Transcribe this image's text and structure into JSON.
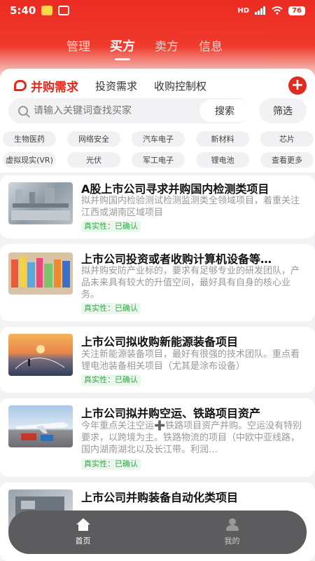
{
  "status_bar": {
    "time": "5:40",
    "signal": "HD",
    "battery": "76"
  },
  "top_tabs": [
    {
      "label": "管理"
    },
    {
      "label": "买方"
    },
    {
      "label": "卖方"
    },
    {
      "label": "信息"
    }
  ],
  "sub_tabs": [
    {
      "label": "并购需求"
    },
    {
      "label": "投资需求"
    },
    {
      "label": "收购控制权"
    }
  ],
  "search": {
    "placeholder": "请输入关键词查找买家",
    "button_label": "搜索",
    "filter_label": "筛选"
  },
  "chips_row1": [
    "生物医药",
    "网络安全",
    "汽车电子",
    "新材料",
    "芯片"
  ],
  "chips_row2": [
    "虚拟现实(VR)",
    "光伏",
    "军工电子",
    "锂电池",
    "查看更多"
  ],
  "cards": [
    {
      "title": "A股上市公司寻求并购国内检测类项目",
      "desc": "拟并购国内检验测试检测监测类全领域项目，着重关注江西或湖南区域项目",
      "badge": "真实性：已确认",
      "thumb": "factory-photo"
    },
    {
      "title": "上市公司投资或者收购计算机设备等…",
      "desc": "拟并购安防产业标的，要求有足够专业的研发团队，产品未来具有较大的升值空间，最好具有自身的核心业务。",
      "badge": "真实性：已确认",
      "thumb": "products-photo"
    },
    {
      "title": "上市公司拟收购新能源装备项目",
      "desc": "关注新能源装备项目，最好有很强的技术团队。重点看锂电池装备相关项目（尤其是涂布设备）",
      "badge": "真实性：已确认",
      "thumb": "sunset-photo"
    },
    {
      "title": "上市公司拟并购空运、铁路项目资产",
      "desc": "今年重点关注空运➕铁路项目资产并购。空运没有特别要求，以跨境为主。铁路物流的项目（中欧中亚线路，国内湖南湖北以及长江带。利润…",
      "badge": "真实性：已确认",
      "thumb": "airplane-photo"
    },
    {
      "title": "上市公司并购装备自动化类项目",
      "desc": "",
      "badge": "",
      "thumb": "machine-photo"
    }
  ],
  "bottom_nav": [
    {
      "label": "首页"
    },
    {
      "label": "我的"
    }
  ],
  "colors": {
    "brand_red": "#e02a20",
    "badge_green": "#3aa54c",
    "nav_bg": "#5c5c5e"
  }
}
